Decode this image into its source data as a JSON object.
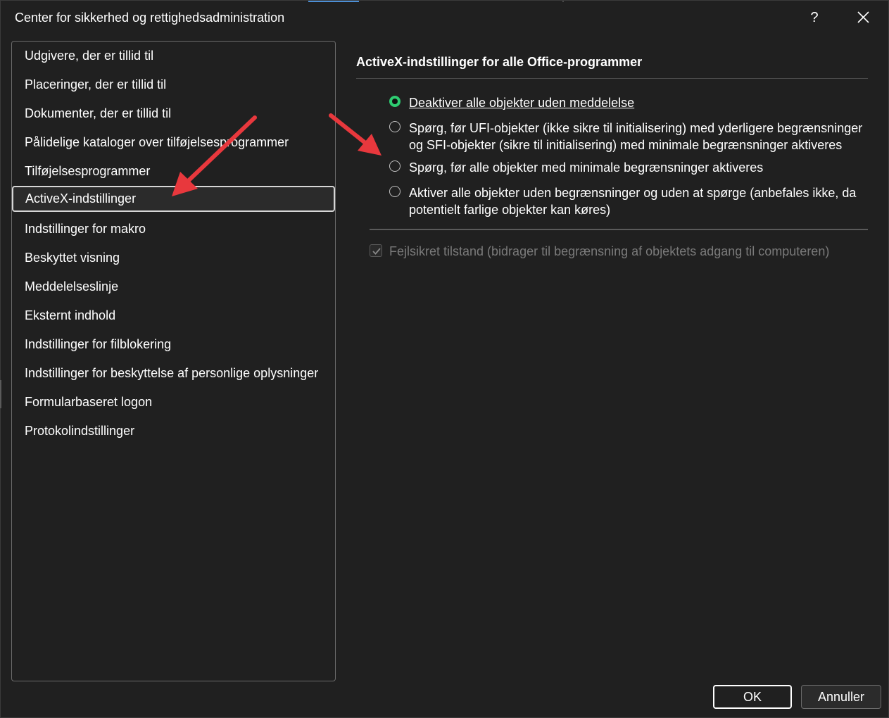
{
  "window": {
    "title": "Center for sikkerhed og rettighedsadministration",
    "help_label": "?"
  },
  "sidebar": {
    "items": [
      {
        "label": "Udgivere, der er tillid til"
      },
      {
        "label": "Placeringer, der er tillid til"
      },
      {
        "label": "Dokumenter, der er tillid til"
      },
      {
        "label": "Pålidelige kataloger over tilføjelsesprogrammer"
      },
      {
        "label": "Tilføjelsesprogrammer"
      },
      {
        "label": "ActiveX-indstillinger",
        "selected": true
      },
      {
        "label": "Indstillinger for makro"
      },
      {
        "label": "Beskyttet visning"
      },
      {
        "label": "Meddelelseslinje"
      },
      {
        "label": "Eksternt indhold"
      },
      {
        "label": "Indstillinger for filblokering"
      },
      {
        "label": "Indstillinger for beskyttelse af personlige oplysninger"
      },
      {
        "label": "Formularbaseret logon"
      },
      {
        "label": "Protokolindstillinger"
      }
    ]
  },
  "main": {
    "section_title": "ActiveX-indstillinger for alle Office-programmer",
    "options": [
      {
        "lines": [
          "Deaktiver alle objekter uden meddelelse"
        ],
        "checked": true
      },
      {
        "lines": [
          "Spørg, før UFI-objekter (ikke sikre til initialisering) med yderligere begrænsninger",
          "og SFI-objekter (sikre til initialisering) med minimale begrænsninger aktiveres"
        ],
        "checked": false
      },
      {
        "lines": [
          "Spørg, før alle objekter med minimale begrænsninger aktiveres"
        ],
        "checked": false
      },
      {
        "lines": [
          "Aktiver alle objekter uden begrænsninger og uden at spørge (anbefales ikke, da",
          "potentielt farlige objekter kan køres)"
        ],
        "checked": false
      }
    ],
    "safe_mode_label": "Fejlsikret tilstand (bidrager til begrænsning af objektets adgang til computeren)",
    "safe_mode_checked": true,
    "safe_mode_disabled": true
  },
  "footer": {
    "ok_label": "OK",
    "cancel_label": "Annuller"
  },
  "colors": {
    "background": "#202020",
    "radio_selected": "#2ecc71",
    "annotation_arrow": "#e8383d"
  }
}
